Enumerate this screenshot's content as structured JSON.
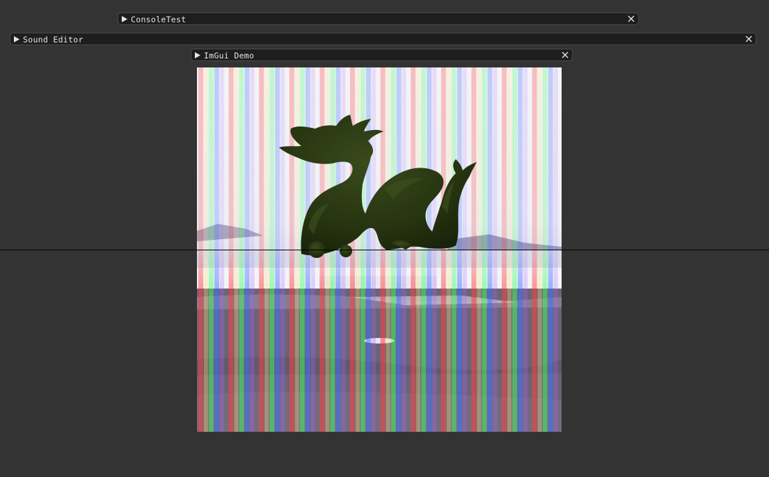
{
  "windows": {
    "console_test": {
      "title": "ConsoleTest",
      "collapsed": true
    },
    "sound_editor": {
      "title": "Sound Editor",
      "collapsed": true
    },
    "imgui_demo": {
      "title": "ImGui Demo",
      "collapsed": true
    }
  },
  "icons": {
    "collapse": "triangle-right-icon",
    "close": "close-icon"
  },
  "colors": {
    "background": "#333333",
    "title_bar": "#1e1e1e",
    "text": "#e6e6e6",
    "dragon": "#25330f"
  }
}
